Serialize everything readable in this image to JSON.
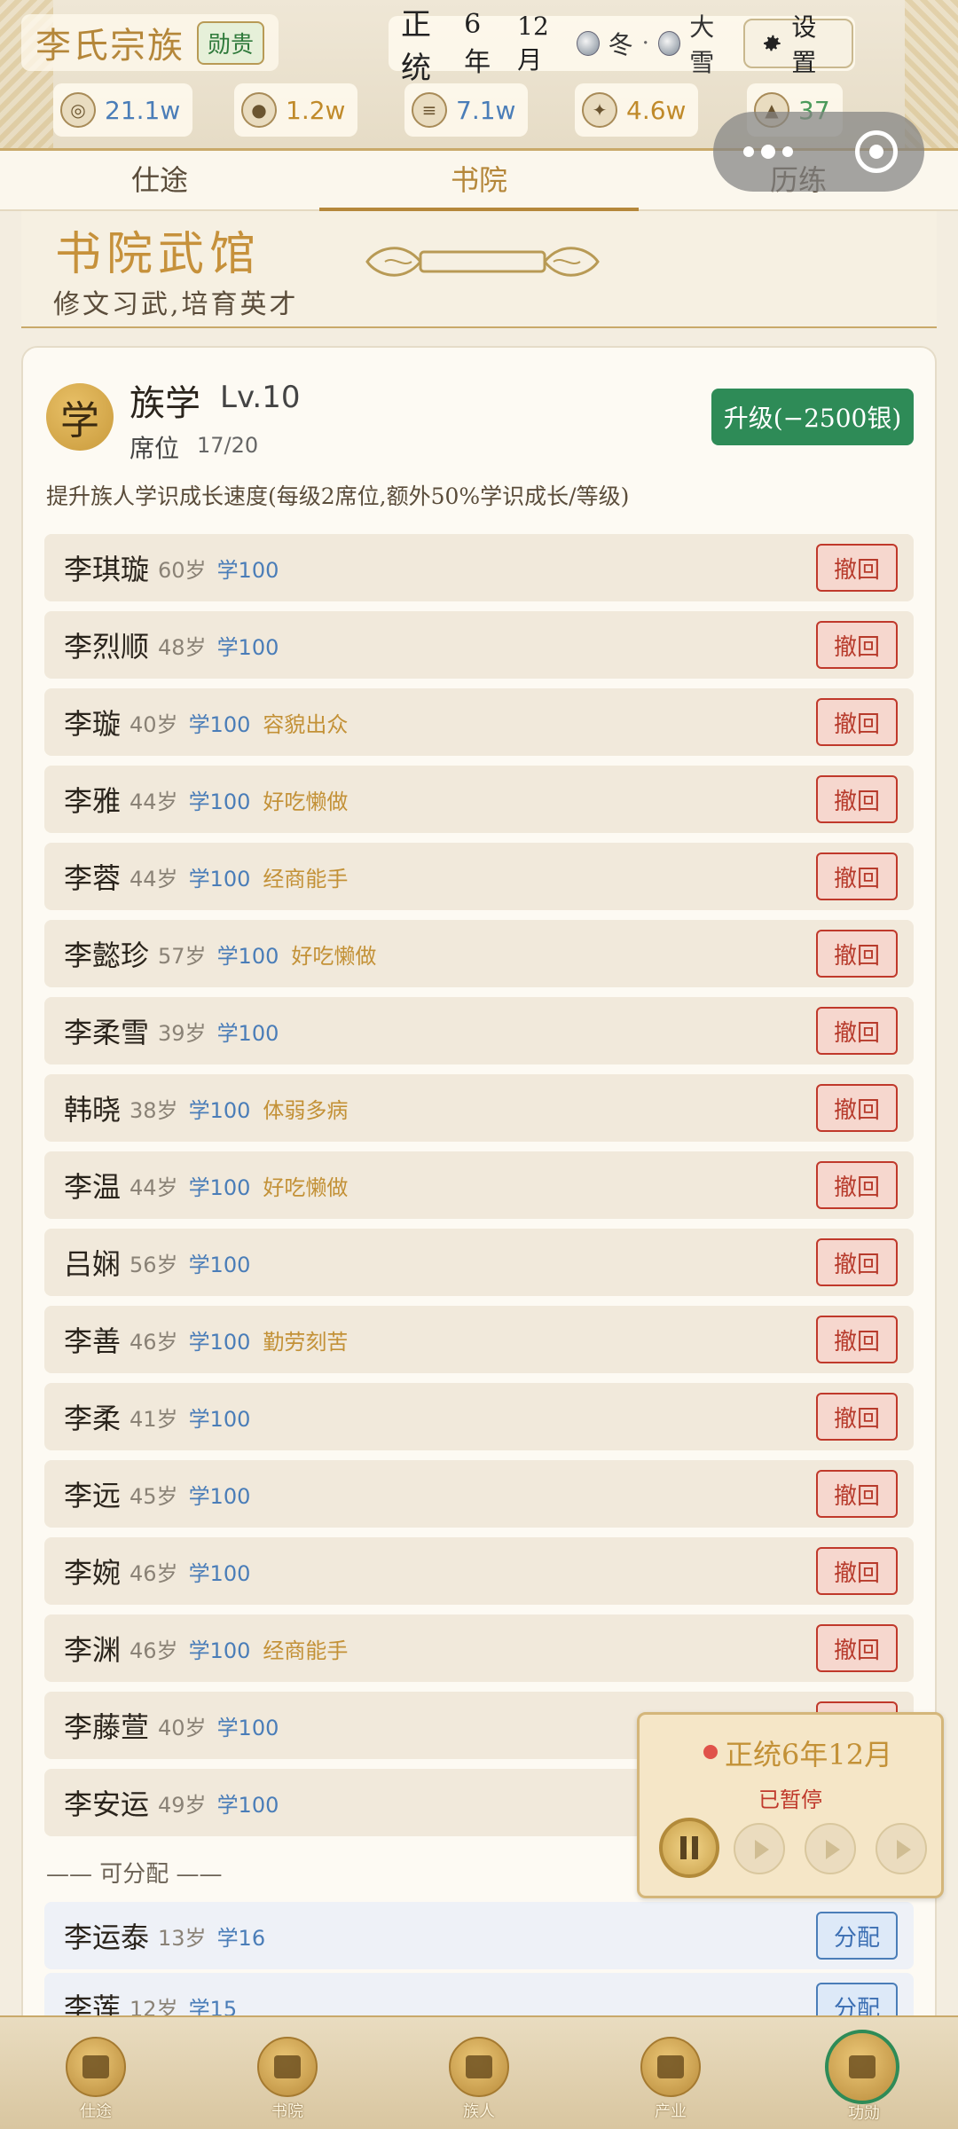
{
  "header": {
    "clan_name": "李氏宗族",
    "rank_badge": "勋贵",
    "era": "正统",
    "year": "6年",
    "month": "12月",
    "season_icon": "yin-yang-icon",
    "season": "冬",
    "separator": "·",
    "weather_icon": "snow-icon",
    "weather": "大雪",
    "settings_icon": "gear-icon",
    "settings_label": "设置",
    "resources": [
      {
        "icon": "silver-icon",
        "value": "21.1w",
        "color": "#4a7db8"
      },
      {
        "icon": "grain-bag-icon",
        "value": "1.2w",
        "color": "#c08a2a"
      },
      {
        "icon": "cloth-icon",
        "value": "7.1w",
        "color": "#4a7db8"
      },
      {
        "icon": "prestige-icon",
        "value": "4.6w",
        "color": "#c08a2a"
      },
      {
        "icon": "household-icon",
        "value": "37",
        "color": "#4b9a5b"
      }
    ]
  },
  "tabs": [
    {
      "label": "仕途",
      "active": false
    },
    {
      "label": "书院",
      "active": true
    },
    {
      "label": "历练",
      "active": false
    }
  ],
  "banner": {
    "title": "书院武馆",
    "subtitle": "修文习武,培育英才"
  },
  "institution": {
    "badge": "学",
    "name": "族学",
    "level": "Lv.10",
    "seat_label": "席位",
    "seat_value": "17/20",
    "upgrade_label": "升级(−2500银)",
    "description": "提升族人学识成长速度(每级2席位,额外50%学识成长/等级)"
  },
  "recall_label": "撤回",
  "assign_label": "分配",
  "members": [
    {
      "name": "李琪璇",
      "age": "60岁",
      "study": "学100",
      "trait": ""
    },
    {
      "name": "李烈顺",
      "age": "48岁",
      "study": "学100",
      "trait": ""
    },
    {
      "name": "李璇",
      "age": "40岁",
      "study": "学100",
      "trait": "容貌出众"
    },
    {
      "name": "李雅",
      "age": "44岁",
      "study": "学100",
      "trait": "好吃懒做"
    },
    {
      "name": "李蓉",
      "age": "44岁",
      "study": "学100",
      "trait": "经商能手"
    },
    {
      "name": "李懿珍",
      "age": "57岁",
      "study": "学100",
      "trait": "好吃懒做"
    },
    {
      "name": "李柔雪",
      "age": "39岁",
      "study": "学100",
      "trait": ""
    },
    {
      "name": "韩晓",
      "age": "38岁",
      "study": "学100",
      "trait": "体弱多病"
    },
    {
      "name": "李温",
      "age": "44岁",
      "study": "学100",
      "trait": "好吃懒做"
    },
    {
      "name": "吕娴",
      "age": "56岁",
      "study": "学100",
      "trait": ""
    },
    {
      "name": "李善",
      "age": "46岁",
      "study": "学100",
      "trait": "勤劳刻苦"
    },
    {
      "name": "李柔",
      "age": "41岁",
      "study": "学100",
      "trait": ""
    },
    {
      "name": "李远",
      "age": "45岁",
      "study": "学100",
      "trait": ""
    },
    {
      "name": "李婉",
      "age": "46岁",
      "study": "学100",
      "trait": ""
    },
    {
      "name": "李渊",
      "age": "46岁",
      "study": "学100",
      "trait": "经商能手"
    },
    {
      "name": "李藤萱",
      "age": "40岁",
      "study": "学100",
      "trait": ""
    },
    {
      "name": "李安运",
      "age": "49岁",
      "study": "学100",
      "trait": ""
    }
  ],
  "assignable_label": "——  可分配  ——",
  "assignable": [
    {
      "name": "李运泰",
      "age": "13岁",
      "study": "学16"
    },
    {
      "name": "李莲",
      "age": "12岁",
      "study": "学15"
    }
  ],
  "time_widget": {
    "date": "正统6年12月",
    "status": "已暂停",
    "buttons": [
      "pause-icon",
      "play-icon",
      "fast-forward-icon",
      "fastest-forward-icon"
    ]
  },
  "bottom_nav": [
    {
      "label": "仕途",
      "icon": "book-icon"
    },
    {
      "label": "书院",
      "icon": "academy-icon"
    },
    {
      "label": "族人",
      "icon": "people-icon"
    },
    {
      "label": "产业",
      "icon": "scroll-icon"
    },
    {
      "label": "功勋",
      "icon": "merit-icon",
      "active": true
    }
  ]
}
